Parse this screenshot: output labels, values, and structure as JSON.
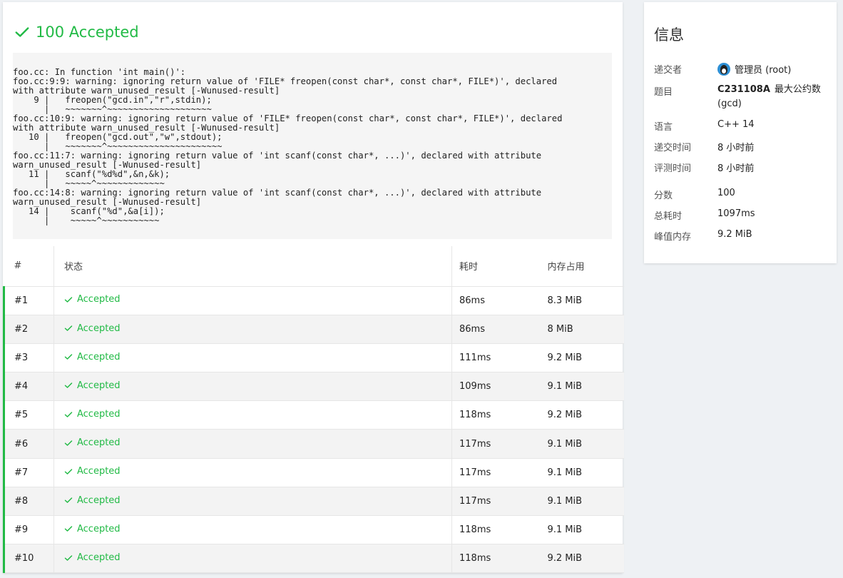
{
  "verdict": {
    "score": "100",
    "status": "Accepted"
  },
  "compile_output": "foo.cc: In function 'int main()':\nfoo.cc:9:9: warning: ignoring return value of 'FILE* freopen(const char*, const char*, FILE*)', declared\nwith attribute warn_unused_result [-Wunused-result]\n    9 |   freopen(\"gcd.in\",\"r\",stdin);\n      |   ~~~~~~~^~~~~~~~~~~~~~~~~~~~~\nfoo.cc:10:9: warning: ignoring return value of 'FILE* freopen(const char*, const char*, FILE*)', declared\nwith attribute warn_unused_result [-Wunused-result]\n   10 |   freopen(\"gcd.out\",\"w\",stdout);\n      |   ~~~~~~~^~~~~~~~~~~~~~~~~~~~~~~\nfoo.cc:11:7: warning: ignoring return value of 'int scanf(const char*, ...)', declared with attribute\nwarn_unused_result [-Wunused-result]\n   11 |   scanf(\"%d%d\",&n,&k);\n      |   ~~~~~^~~~~~~~~~~~~~\nfoo.cc:14:8: warning: ignoring return value of 'int scanf(const char*, ...)', declared with attribute\nwarn_unused_result [-Wunused-result]\n   14 |    scanf(\"%d\",&a[i]);\n      |    ~~~~~^~~~~~~~~~~~",
  "table": {
    "headers": {
      "idx": "#",
      "status": "状态",
      "time": "耗时",
      "memory": "内存占用"
    },
    "rows": [
      {
        "idx": "#1",
        "status": "Accepted",
        "time": "86ms",
        "memory": "8.3 MiB"
      },
      {
        "idx": "#2",
        "status": "Accepted",
        "time": "86ms",
        "memory": "8 MiB"
      },
      {
        "idx": "#3",
        "status": "Accepted",
        "time": "111ms",
        "memory": "9.2 MiB"
      },
      {
        "idx": "#4",
        "status": "Accepted",
        "time": "109ms",
        "memory": "9.1 MiB"
      },
      {
        "idx": "#5",
        "status": "Accepted",
        "time": "118ms",
        "memory": "9.2 MiB"
      },
      {
        "idx": "#6",
        "status": "Accepted",
        "time": "117ms",
        "memory": "9.1 MiB"
      },
      {
        "idx": "#7",
        "status": "Accepted",
        "time": "117ms",
        "memory": "9.1 MiB"
      },
      {
        "idx": "#8",
        "status": "Accepted",
        "time": "117ms",
        "memory": "9.1 MiB"
      },
      {
        "idx": "#9",
        "status": "Accepted",
        "time": "118ms",
        "memory": "9.1 MiB"
      },
      {
        "idx": "#10",
        "status": "Accepted",
        "time": "118ms",
        "memory": "9.2 MiB"
      }
    ]
  },
  "info": {
    "title": "信息",
    "submitter_label": "递交者",
    "submitter": "管理员 (root)",
    "problem_label": "题目",
    "problem_id": "C231108A",
    "problem_name": "最大公约数",
    "problem_alias": "(gcd)",
    "language_label": "语言",
    "language": "C++ 14",
    "submit_time_label": "递交时间",
    "submit_time": "8 小时前",
    "judge_time_label": "评测时间",
    "judge_time": "8 小时前",
    "score_label": "分数",
    "score": "100",
    "total_time_label": "总耗时",
    "total_time": "1097ms",
    "peak_memory_label": "峰值内存",
    "peak_memory": "9.2 MiB"
  },
  "colors": {
    "accepted": "#21ba45",
    "link": "#4a90c9",
    "code_bg": "#f5f5f5"
  },
  "icons": {
    "verdict": "check-icon",
    "row_status": "check-icon",
    "avatar": "penguin-avatar"
  }
}
